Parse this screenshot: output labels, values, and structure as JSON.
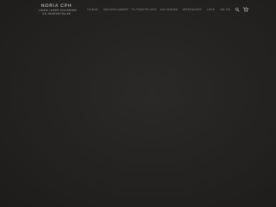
{
  "brand": {
    "title": "NORIA CPH",
    "subtitle_line1": "LAVES LASER HVILEMINS",
    "subtitle_line2": "OG SAUEARTIALHE"
  },
  "nav": {
    "items": [
      {
        "label": "TILBUD"
      },
      {
        "label": "SMYKKELABBER"
      },
      {
        "label": "TILTSMOTELSEO"
      },
      {
        "label": "HALSKRING"
      },
      {
        "label": "ØRERINGER"
      },
      {
        "label": "LÅVE"
      },
      {
        "label": "OM OS"
      }
    ]
  },
  "header_icons": {
    "search": "search-icon",
    "cart": "cart-icon",
    "cart_count": "0"
  },
  "colors": {
    "background": "#222220",
    "text": "#d8d6d0",
    "nav_text": "#a9a7a2"
  }
}
